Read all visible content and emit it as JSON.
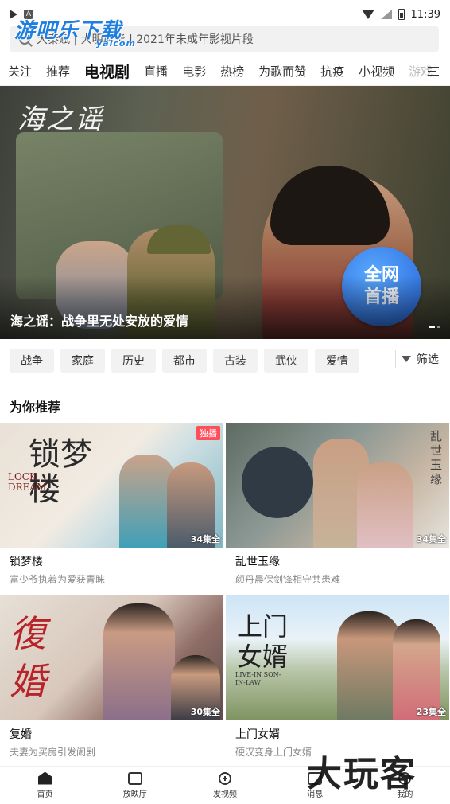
{
  "status_bar": {
    "time": "11:39",
    "notif_letter": "A"
  },
  "watermark": {
    "brand": "游吧乐下载",
    "domain": "yaicom",
    "corner": "大玩客"
  },
  "search": {
    "placeholder": "大秦赋 | 大明风华 | 2021年未成年影视片段"
  },
  "tabs": [
    "关注",
    "推荐",
    "电视剧",
    "直播",
    "电影",
    "热榜",
    "为歌而赞",
    "抗疫",
    "小视频",
    "游戏"
  ],
  "active_tab_index": 2,
  "banner": {
    "logo_text": "海之谣",
    "caption": "海之谣：战争里无处安放的爱情",
    "badge_line1": "全网",
    "badge_line2": "首播"
  },
  "genres": [
    "战争",
    "家庭",
    "历史",
    "都市",
    "古装",
    "武侠",
    "爱情"
  ],
  "filter_label": "筛选",
  "section_title": "为你推荐",
  "cards": [
    {
      "title": "锁梦楼",
      "desc": "富少爷执着为爱获青睐",
      "count": "34集全",
      "exclusive": "独播",
      "poster_text": "锁梦楼",
      "poster_en": "LOCK DREAM"
    },
    {
      "title": "乱世玉缘",
      "desc": "颜丹晨保剑锋相守共患难",
      "count": "34集全",
      "poster_text": "乱世玉缘"
    },
    {
      "title": "复婚",
      "desc": "夫妻为买房引发闹剧",
      "count": "30集全",
      "poster_text": "復婚"
    },
    {
      "title": "上门女婿",
      "desc": "硬汉变身上门女婿",
      "count": "23集全",
      "poster_text": "上门女婿",
      "poster_en": "LIVE-IN SON-IN-LAW"
    }
  ],
  "bottom_nav": [
    "首页",
    "放映厅",
    "发视频",
    "消息",
    "我的"
  ],
  "colors": {
    "accent_blue": "#2563d8",
    "exclusive_red": "#ff4d5a"
  }
}
